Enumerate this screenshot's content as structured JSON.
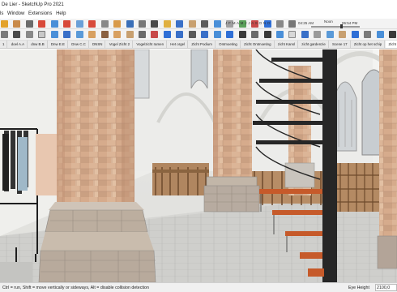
{
  "window": {
    "title": "De Lier - SketchUp Pro 2021"
  },
  "menu": {
    "items": [
      "ls",
      "Window",
      "Extensions",
      "Help"
    ]
  },
  "timeline": {
    "months": "J F M A M J J A S O N D",
    "time_start": "04:25 AM",
    "noon_label": "Noon",
    "time_end": "06:54 PM"
  },
  "scenes": {
    "tabs": [
      "1",
      "doel A.A",
      "dnw B.B",
      "Dnw E.E",
      "Dnw C.C",
      "DNSN",
      "Vogel Zicht 2",
      "Vogelzicht ramen",
      "Het orgel",
      "Zicht Podium",
      "Ontmoeting",
      "Zicht Ontmoeting",
      "zicht Kansl",
      "zicht gardenzie",
      "Scene 17",
      "Zicht op het schip",
      "Zicht Koffiebar"
    ],
    "active_index": 16
  },
  "status": {
    "hint": "Ctrl = run, Shift = move vertically or sideways, Alt = disable collision detection",
    "eye_height_label": "Eye Height",
    "eye_height_value": "2100,0"
  },
  "colors": {
    "accent_blue": "#2f6fd6",
    "stone_light": "#d9ad8f",
    "stone_dark": "#b58466",
    "stair_orange": "#c65a2a",
    "stair_dark": "#262626"
  }
}
